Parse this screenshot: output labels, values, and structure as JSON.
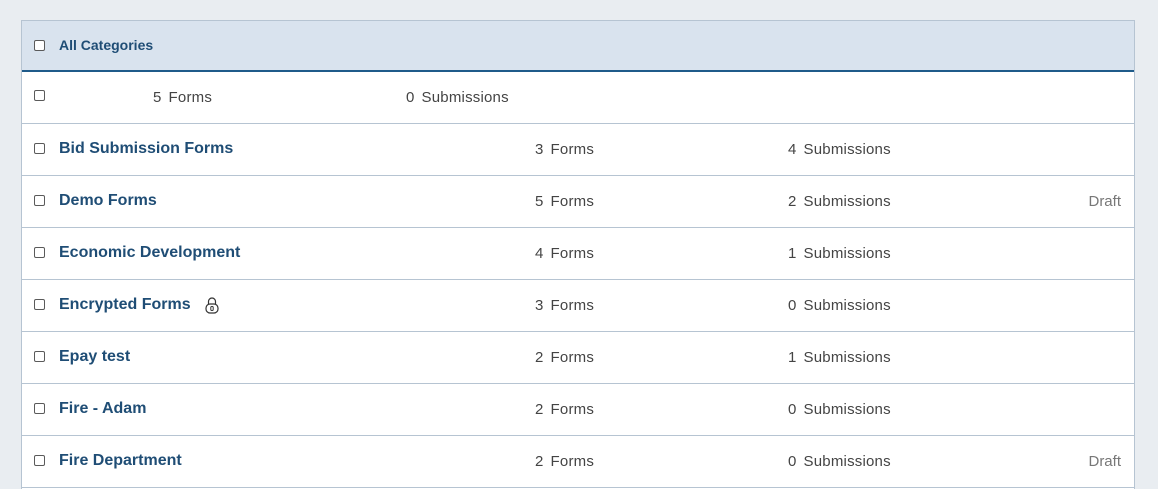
{
  "header": {
    "title": "All Categories"
  },
  "summary": {
    "forms_count": "5",
    "forms_label": "Forms",
    "submissions_count": "0",
    "submissions_label": "Submissions"
  },
  "categories": [
    {
      "name": "Bid Submission Forms",
      "forms_count": "3",
      "forms_label": "Forms",
      "submissions_count": "4",
      "submissions_label": "Submissions",
      "status": "",
      "encrypted": false
    },
    {
      "name": "Demo Forms",
      "forms_count": "5",
      "forms_label": "Forms",
      "submissions_count": "2",
      "submissions_label": "Submissions",
      "status": "Draft",
      "encrypted": false
    },
    {
      "name": "Economic Development",
      "forms_count": "4",
      "forms_label": "Forms",
      "submissions_count": "1",
      "submissions_label": "Submissions",
      "status": "",
      "encrypted": false
    },
    {
      "name": "Encrypted Forms",
      "forms_count": "3",
      "forms_label": "Forms",
      "submissions_count": "0",
      "submissions_label": "Submissions",
      "status": "",
      "encrypted": true
    },
    {
      "name": "Epay test",
      "forms_count": "2",
      "forms_label": "Forms",
      "submissions_count": "1",
      "submissions_label": "Submissions",
      "status": "",
      "encrypted": false
    },
    {
      "name": "Fire - Adam",
      "forms_count": "2",
      "forms_label": "Forms",
      "submissions_count": "0",
      "submissions_label": "Submissions",
      "status": "",
      "encrypted": false
    },
    {
      "name": "Fire Department",
      "forms_count": "2",
      "forms_label": "Forms",
      "submissions_count": "0",
      "submissions_label": "Submissions",
      "status": "Draft",
      "encrypted": false
    }
  ],
  "colors": {
    "header_bg": "#d9e3ee",
    "header_border": "#1f5b8a",
    "link": "#1f4d75",
    "row_border": "#b6c4d2",
    "page_bg": "#e9edf1"
  },
  "icons": {
    "encrypted": "lock-icon"
  }
}
